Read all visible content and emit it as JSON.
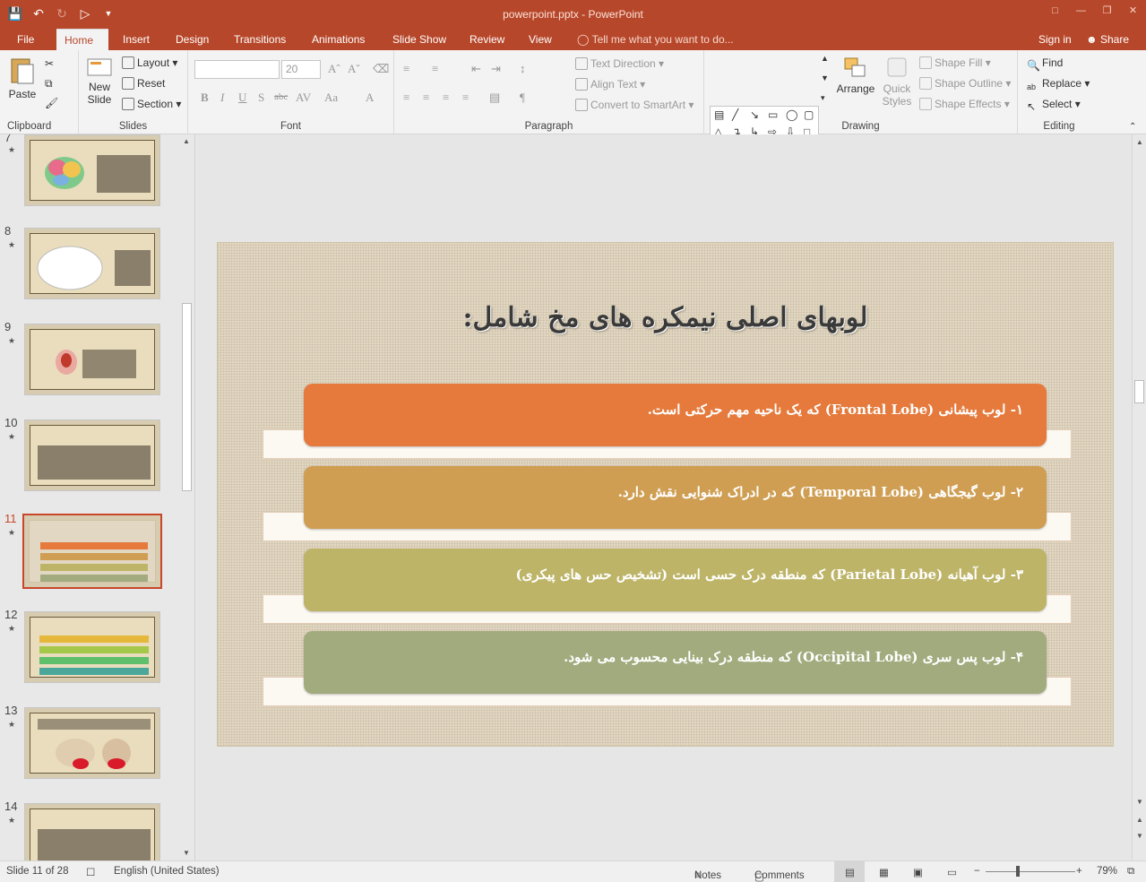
{
  "window": {
    "title": "powerpoint.pptx - PowerPoint"
  },
  "tabs": [
    "File",
    "Home",
    "Insert",
    "Design",
    "Transitions",
    "Animations",
    "Slide Show",
    "Review",
    "View"
  ],
  "active_tab": "Home",
  "tell_me": "Tell me what you want to do...",
  "sign_in": "Sign in",
  "share": "Share",
  "ribbon": {
    "clipboard": {
      "paste": "Paste",
      "label": "Clipboard"
    },
    "slides": {
      "new_slide_1": "New",
      "new_slide_2": "Slide",
      "layout": "Layout",
      "reset": "Reset",
      "section": "Section",
      "label": "Slides"
    },
    "font": {
      "font_name": "",
      "font_size": "20",
      "label": "Font"
    },
    "paragraph": {
      "text_direction": "Text Direction",
      "align_text": "Align Text",
      "convert_smartart": "Convert to SmartArt",
      "label": "Paragraph"
    },
    "drawing": {
      "arrange": "Arrange",
      "quick_styles_1": "Quick",
      "quick_styles_2": "Styles",
      "shape_fill": "Shape Fill",
      "shape_outline": "Shape Outline",
      "shape_effects": "Shape Effects",
      "label": "Drawing"
    },
    "editing": {
      "find": "Find",
      "replace": "Replace",
      "select": "Select",
      "label": "Editing"
    }
  },
  "thumbnails": [
    {
      "num": "7",
      "selected": false
    },
    {
      "num": "8",
      "selected": false
    },
    {
      "num": "9",
      "selected": false
    },
    {
      "num": "10",
      "selected": false
    },
    {
      "num": "11",
      "selected": true
    },
    {
      "num": "12",
      "selected": false
    },
    {
      "num": "13",
      "selected": false
    },
    {
      "num": "14",
      "selected": false
    }
  ],
  "slide": {
    "title": "لوبهای اصلی نیمکره های مخ شامل:",
    "items": [
      {
        "text": "۱- لوب پیشانی (Frontal Lobe) که یک ناحیه مهم حرکتی است.",
        "color": "#e57a3c"
      },
      {
        "text": "۲- لوب گیجگاهی (Temporal Lobe) که در ادراک شنوایی نقش دارد.",
        "color": "#cf9e52"
      },
      {
        "text": "۳- لوب آهیانه (Parietal Lobe) که منطقه درک حسی است (تشخیص حس های پیکری)",
        "color": "#bdb468"
      },
      {
        "text": "۴- لوب پس سری (Occipital Lobe) که منطقه درک بینایی محسوب می شود.",
        "color": "#a2ab7e"
      }
    ]
  },
  "status": {
    "slide_info": "Slide 11 of 28",
    "language": "English (United States)",
    "notes": "Notes",
    "comments": "Comments",
    "zoom": "79%"
  },
  "colors": {
    "accent": "#b7472a"
  }
}
